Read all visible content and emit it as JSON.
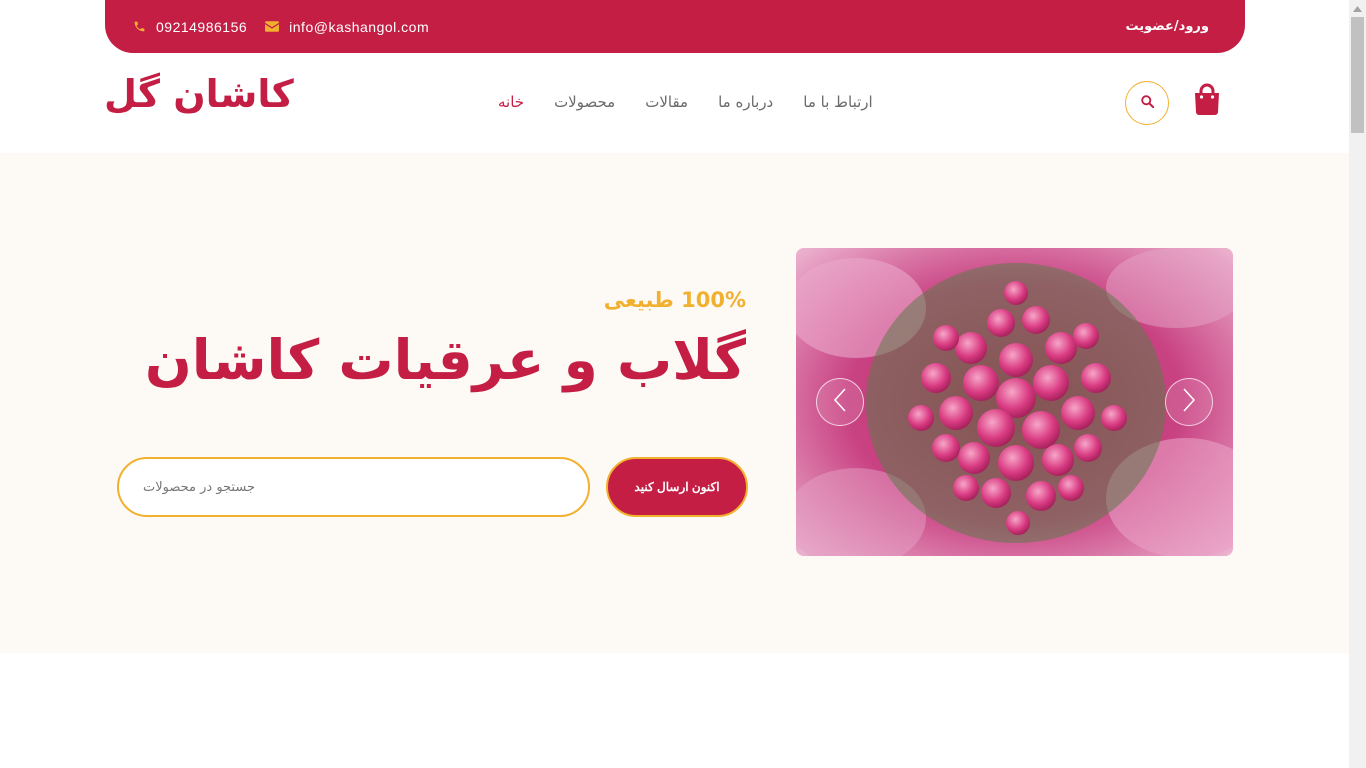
{
  "topbar": {
    "phone": "09214986156",
    "email": "info@kashangol.com",
    "login": "ورود/عضویت",
    "icons": [
      "phone-icon",
      "envelope-icon"
    ]
  },
  "header": {
    "logo": "کاشان گل",
    "nav": [
      {
        "label": "خانه",
        "active": true
      },
      {
        "label": "محصولات",
        "active": false
      },
      {
        "label": "مقالات",
        "active": false
      },
      {
        "label": "درباره ما",
        "active": false
      },
      {
        "label": "ارتباط با ما",
        "active": false
      }
    ],
    "icons": [
      "search-icon",
      "shopping-bag-icon"
    ]
  },
  "hero": {
    "eyebrow": "100% طبیعی",
    "headline": "گلاب و عرقیات کاشان",
    "cta_label": "اکنون ارسال کنید",
    "search_placeholder": "جستجو در محصولات",
    "slider_icons": [
      "chevron-left-icon",
      "chevron-right-icon"
    ]
  },
  "colors": {
    "primary": "#c41e45",
    "accent": "#f2b02f",
    "hero_bg": "#fdfaf5",
    "nav_text": "#6b6b6b"
  }
}
